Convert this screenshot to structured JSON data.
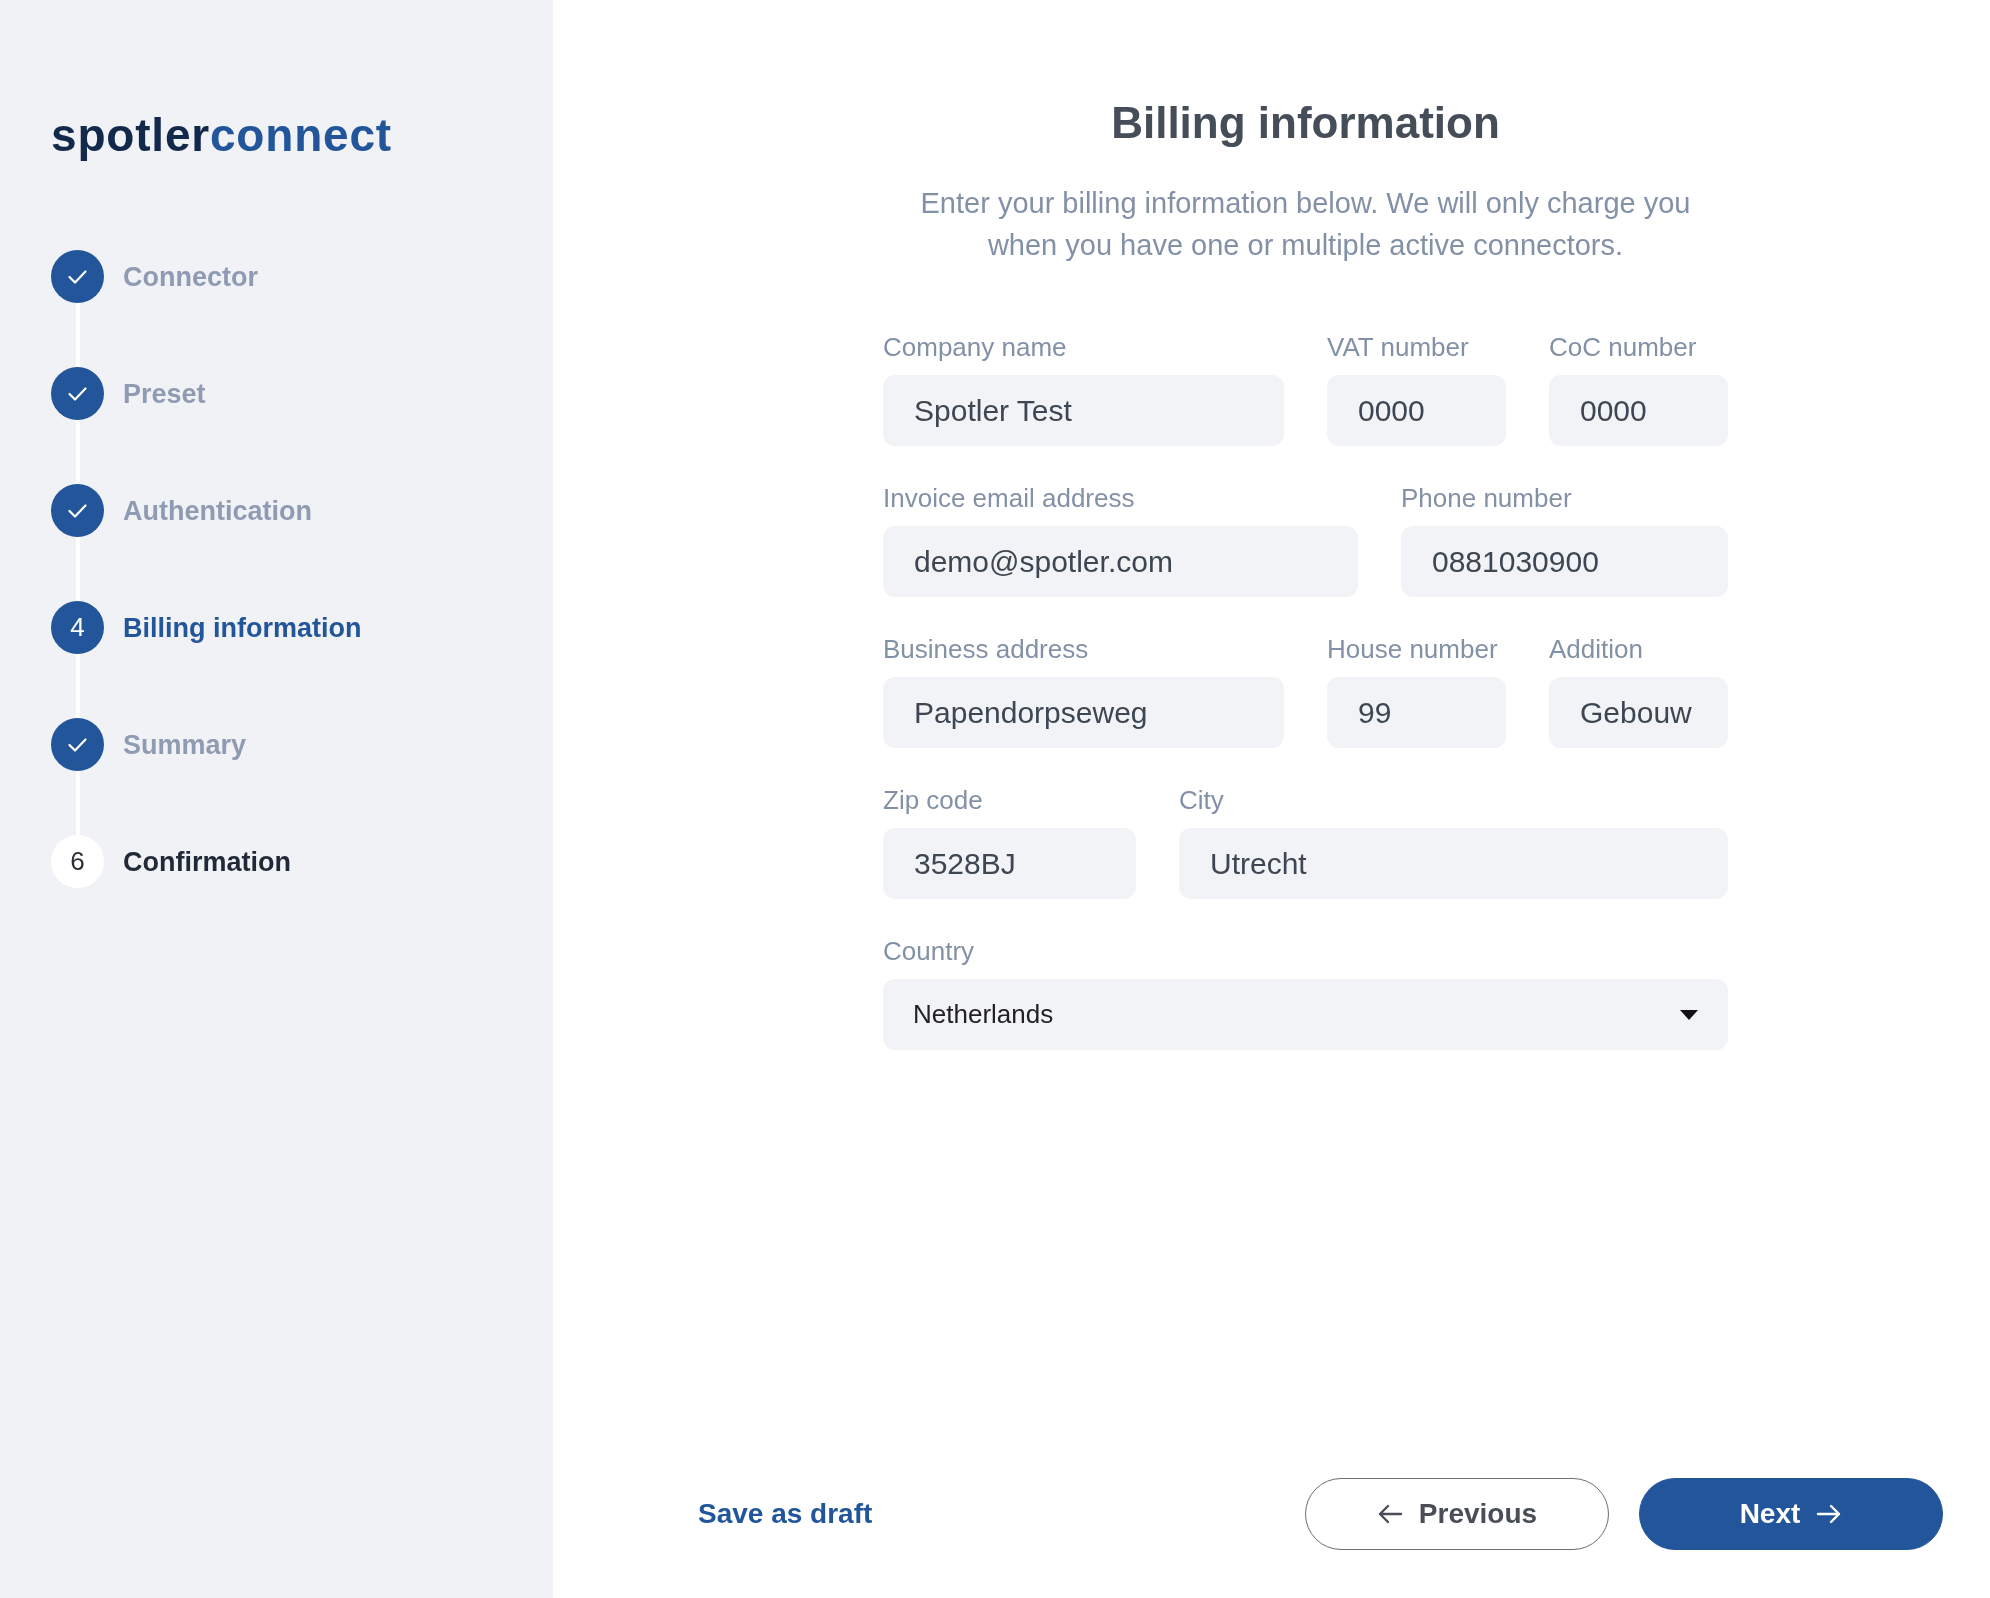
{
  "logo": {
    "primary": "spotler",
    "secondary": "connect"
  },
  "steps": [
    {
      "label": "Connector",
      "completed": true,
      "selected": false
    },
    {
      "label": "Preset",
      "completed": true,
      "selected": false
    },
    {
      "label": "Authentication",
      "completed": true,
      "selected": false
    },
    {
      "label": "Billing information",
      "completed": false,
      "selected": true,
      "number": "4"
    },
    {
      "label": "Summary",
      "completed": true,
      "selected": false
    },
    {
      "label": "Confirmation",
      "completed": false,
      "selected": false,
      "number": "6"
    }
  ],
  "form": {
    "title": "Billing information",
    "description": "Enter your billing information below. We will only charge you when you have one or multiple active connectors.",
    "rows": [
      [
        {
          "label": "Company name",
          "value": "Spotler Test",
          "kind": "text"
        },
        {
          "label": "VAT number",
          "value": "0000",
          "kind": "text"
        },
        {
          "label": "CoC number",
          "value": "0000",
          "kind": "text"
        }
      ],
      [
        {
          "label": "Invoice email address",
          "value": "demo@spotler.com",
          "kind": "text"
        },
        {
          "label": "Phone number",
          "value": "0881030900",
          "kind": "text"
        }
      ],
      [
        {
          "label": "Business address",
          "value": "Papendorpseweg",
          "kind": "text"
        },
        {
          "label": "House number",
          "value": "99",
          "kind": "text"
        },
        {
          "label": "Addition",
          "value": "Gebouw",
          "kind": "text"
        }
      ],
      [
        {
          "label": "Zip code",
          "value": "3528BJ",
          "kind": "text"
        },
        {
          "label": "City",
          "value": "Utrecht",
          "kind": "text"
        }
      ],
      [
        {
          "label": "Country",
          "value": "Netherlands",
          "kind": "select"
        }
      ]
    ]
  },
  "actions": [
    {
      "label": "Save as draft",
      "kind": "link"
    },
    {
      "label": "Previous",
      "kind": "secondary"
    },
    {
      "label": "Next",
      "kind": "primary"
    }
  ]
}
